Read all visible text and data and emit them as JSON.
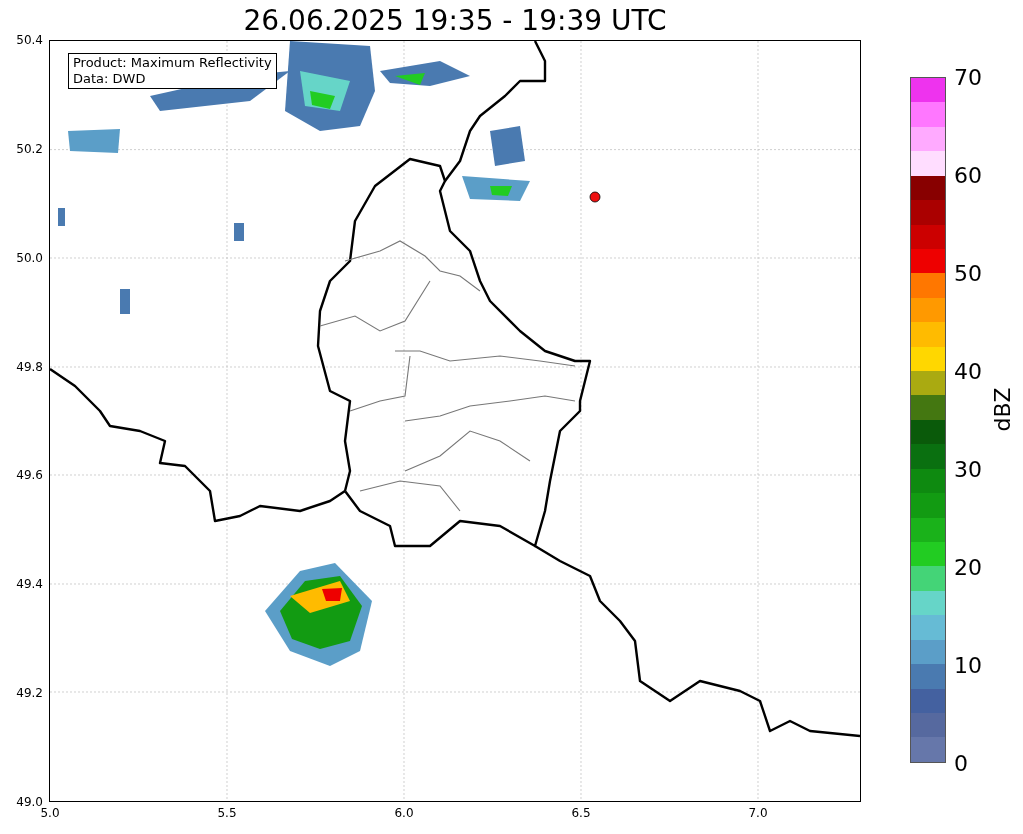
{
  "title": "26.06.2025 19:35 - 19:39 UTC",
  "annotation": {
    "lines": [
      "Product: Maximum Reflectivity",
      "Data: DWD"
    ]
  },
  "axes": {
    "x_ticks": [
      "5.0",
      "5.5",
      "6.0",
      "6.5",
      "7.0"
    ],
    "y_ticks": [
      "50.4",
      "50.2",
      "50.0",
      "49.8",
      "49.6",
      "49.4",
      "49.2",
      "49.0"
    ]
  },
  "colorbar": {
    "label": "dBZ",
    "ticks": [
      "70",
      "60",
      "50",
      "40",
      "30",
      "20",
      "10",
      "0"
    ],
    "bands": [
      {
        "color": "#ee33ee"
      },
      {
        "color": "#ff77ff"
      },
      {
        "color": "#ffaaff"
      },
      {
        "color": "#ffddff"
      },
      {
        "color": "#880000"
      },
      {
        "color": "#aa0000"
      },
      {
        "color": "#cc0000"
      },
      {
        "color": "#ee0000"
      },
      {
        "color": "#ff7700"
      },
      {
        "color": "#ff9900"
      },
      {
        "color": "#ffbb00"
      },
      {
        "color": "#ffd700"
      },
      {
        "color": "#aaaa11"
      },
      {
        "color": "#447711"
      },
      {
        "color": "#0a5a0a"
      },
      {
        "color": "#0a7010"
      },
      {
        "color": "#0e8a10"
      },
      {
        "color": "#129b12"
      },
      {
        "color": "#1ab21a"
      },
      {
        "color": "#22cc22"
      },
      {
        "color": "#44d477"
      },
      {
        "color": "#66d5c8"
      },
      {
        "color": "#66bbd5"
      },
      {
        "color": "#5b9ec8"
      },
      {
        "color": "#4a7ab0"
      },
      {
        "color": "#4461a0"
      },
      {
        "color": "#56699f"
      },
      {
        "color": "#6677aa"
      }
    ]
  }
}
